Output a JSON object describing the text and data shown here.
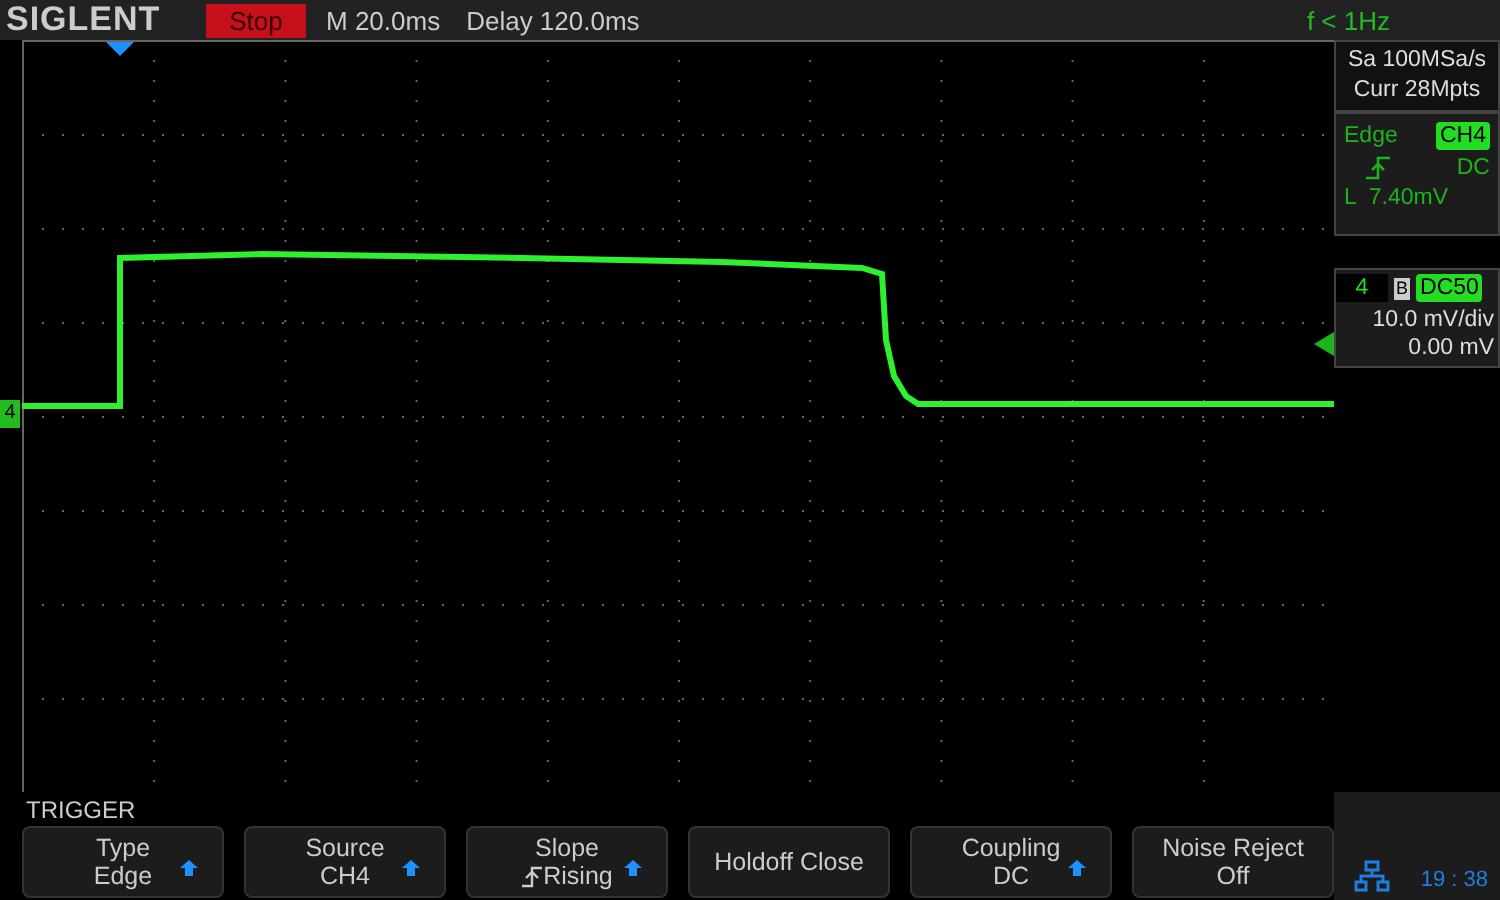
{
  "top_bar": {
    "brand": "SIGLENT",
    "run_state": "Stop",
    "timebase": "M 20.0ms",
    "delay": "Delay 120.0ms",
    "frequency": "f < 1Hz"
  },
  "acquisition": {
    "sample_rate": "Sa 100MSa/s",
    "memory": "Curr 28Mpts"
  },
  "trigger_info": {
    "type": "Edge",
    "source": "CH4",
    "coupling": "DC",
    "level": "L  7.40mV"
  },
  "channel": {
    "number": "4",
    "bandwidth_limit": "B",
    "impedance": "DC50",
    "scale": "10.0 mV/div",
    "offset": "0.00 mV"
  },
  "ground_marker": "4",
  "menu": {
    "title": "TRIGGER",
    "buttons": [
      {
        "label": "Type",
        "value": "Edge",
        "kind": "select"
      },
      {
        "label": "Source",
        "value": "CH4",
        "kind": "select"
      },
      {
        "label": "Slope",
        "value": "Rising",
        "kind": "slope"
      },
      {
        "label": "Holdoff Close",
        "kind": "action"
      },
      {
        "label": "Coupling",
        "value": "DC",
        "kind": "select"
      },
      {
        "label": "Noise Reject",
        "value": "Off",
        "kind": "plain"
      }
    ]
  },
  "status": {
    "time": "19 : 38"
  }
}
